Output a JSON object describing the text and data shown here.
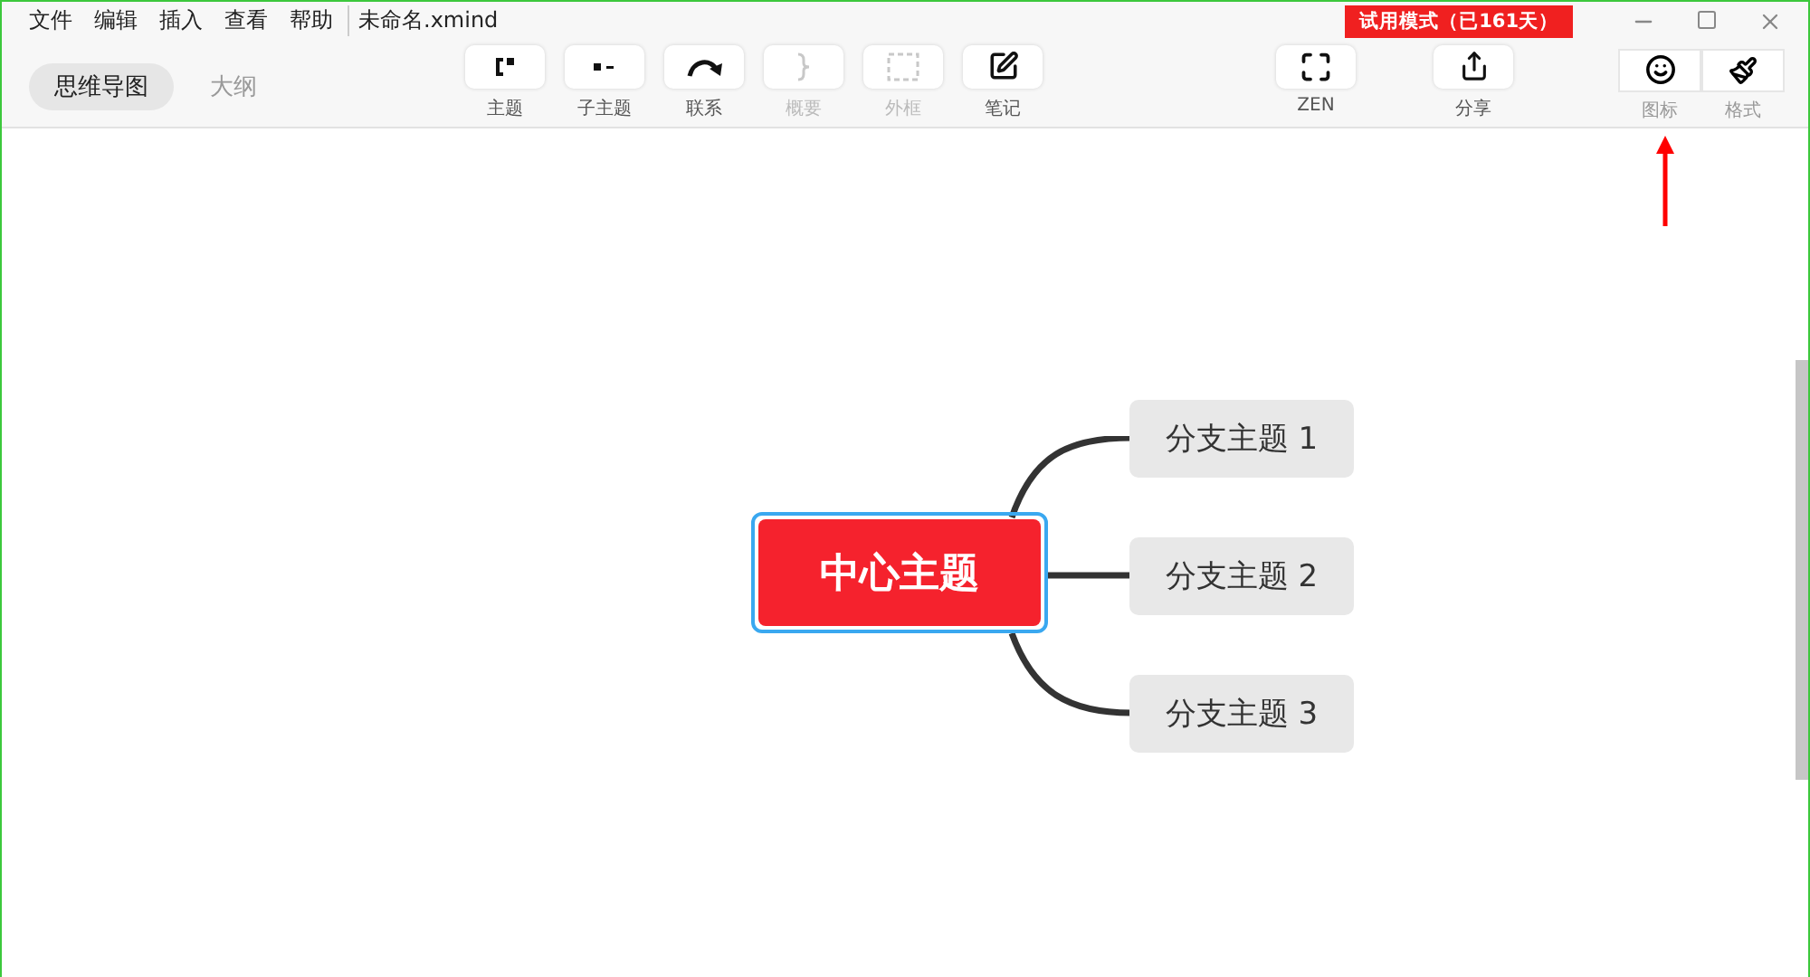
{
  "menu": [
    "文件",
    "编辑",
    "插入",
    "查看",
    "帮助"
  ],
  "file_title": "未命名.xmind",
  "trial_badge": "试用模式（已161天）",
  "view_tabs": [
    {
      "label": "思维导图",
      "selected": true
    },
    {
      "label": "大纲",
      "selected": false
    }
  ],
  "toolbar": [
    {
      "kind": "topic",
      "label": "主题",
      "disabled": false
    },
    {
      "kind": "subtopic",
      "label": "子主题",
      "disabled": false
    },
    {
      "kind": "relation",
      "label": "联系",
      "disabled": false
    },
    {
      "kind": "summary",
      "label": "概要",
      "disabled": true
    },
    {
      "kind": "boundary",
      "label": "外框",
      "disabled": true
    },
    {
      "kind": "note",
      "label": "笔记",
      "disabled": false
    },
    {
      "kind": "zen",
      "label": "ZEN",
      "disabled": false
    },
    {
      "kind": "share",
      "label": "分享",
      "disabled": false
    }
  ],
  "panel_buttons": [
    {
      "kind": "icon",
      "label": "图标"
    },
    {
      "kind": "format",
      "label": "格式"
    }
  ],
  "map": {
    "central": "中心主题",
    "branches": [
      "分支主题 1",
      "分支主题 2",
      "分支主题 3"
    ]
  }
}
